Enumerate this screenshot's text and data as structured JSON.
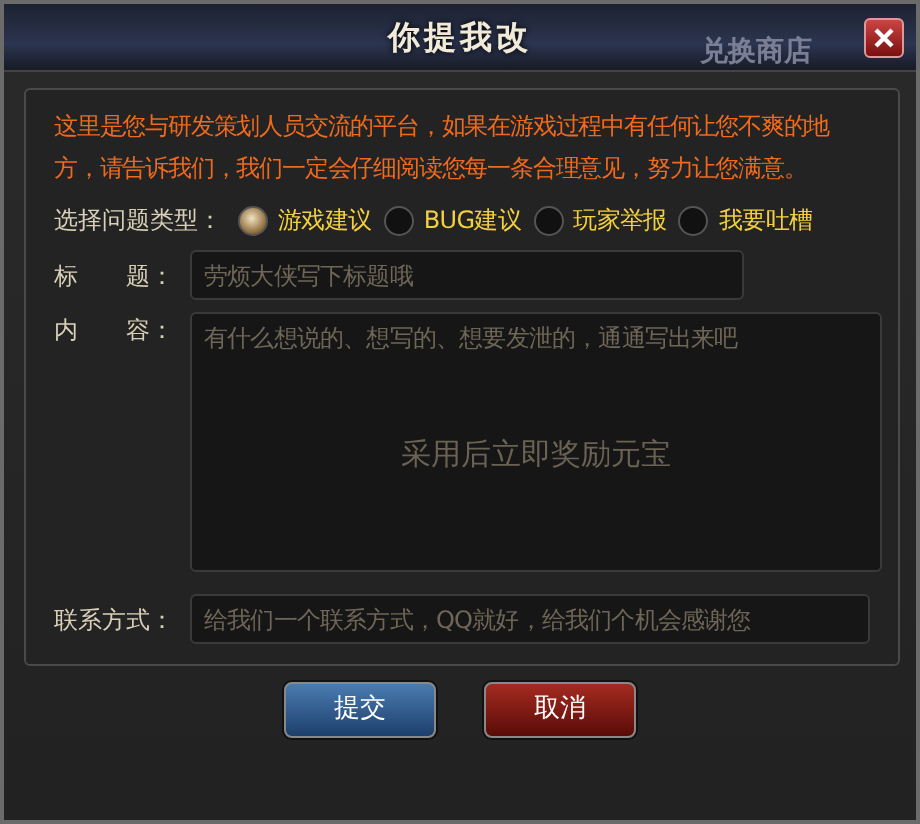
{
  "window": {
    "title": "你提我改",
    "background_text": "兑换商店"
  },
  "intro": "这里是您与研发策划人员交流的平台，如果在游戏过程中有任何让您不爽的地方，请告诉我们，我们一定会仔细阅读您每一条合理意见，努力让您满意。",
  "type_label": "选择问题类型：",
  "types": [
    {
      "label": "游戏建议",
      "selected": true
    },
    {
      "label": "BUG建议",
      "selected": false
    },
    {
      "label": "玩家举报",
      "selected": false
    },
    {
      "label": "我要吐槽",
      "selected": false
    }
  ],
  "title_field": {
    "label": "标　　题：",
    "placeholder": "劳烦大侠写下标题哦"
  },
  "content_field": {
    "label": "内　　容：",
    "placeholder": "有什么想说的、想写的、想要发泄的，通通写出来吧",
    "hint": "采用后立即奖励元宝"
  },
  "contact_field": {
    "label": "联系方式：",
    "placeholder": "给我们一个联系方式，QQ就好，给我们个机会感谢您"
  },
  "buttons": [
    {
      "label": "提交",
      "kind": "primary"
    },
    {
      "label": "取消",
      "kind": "danger"
    }
  ]
}
